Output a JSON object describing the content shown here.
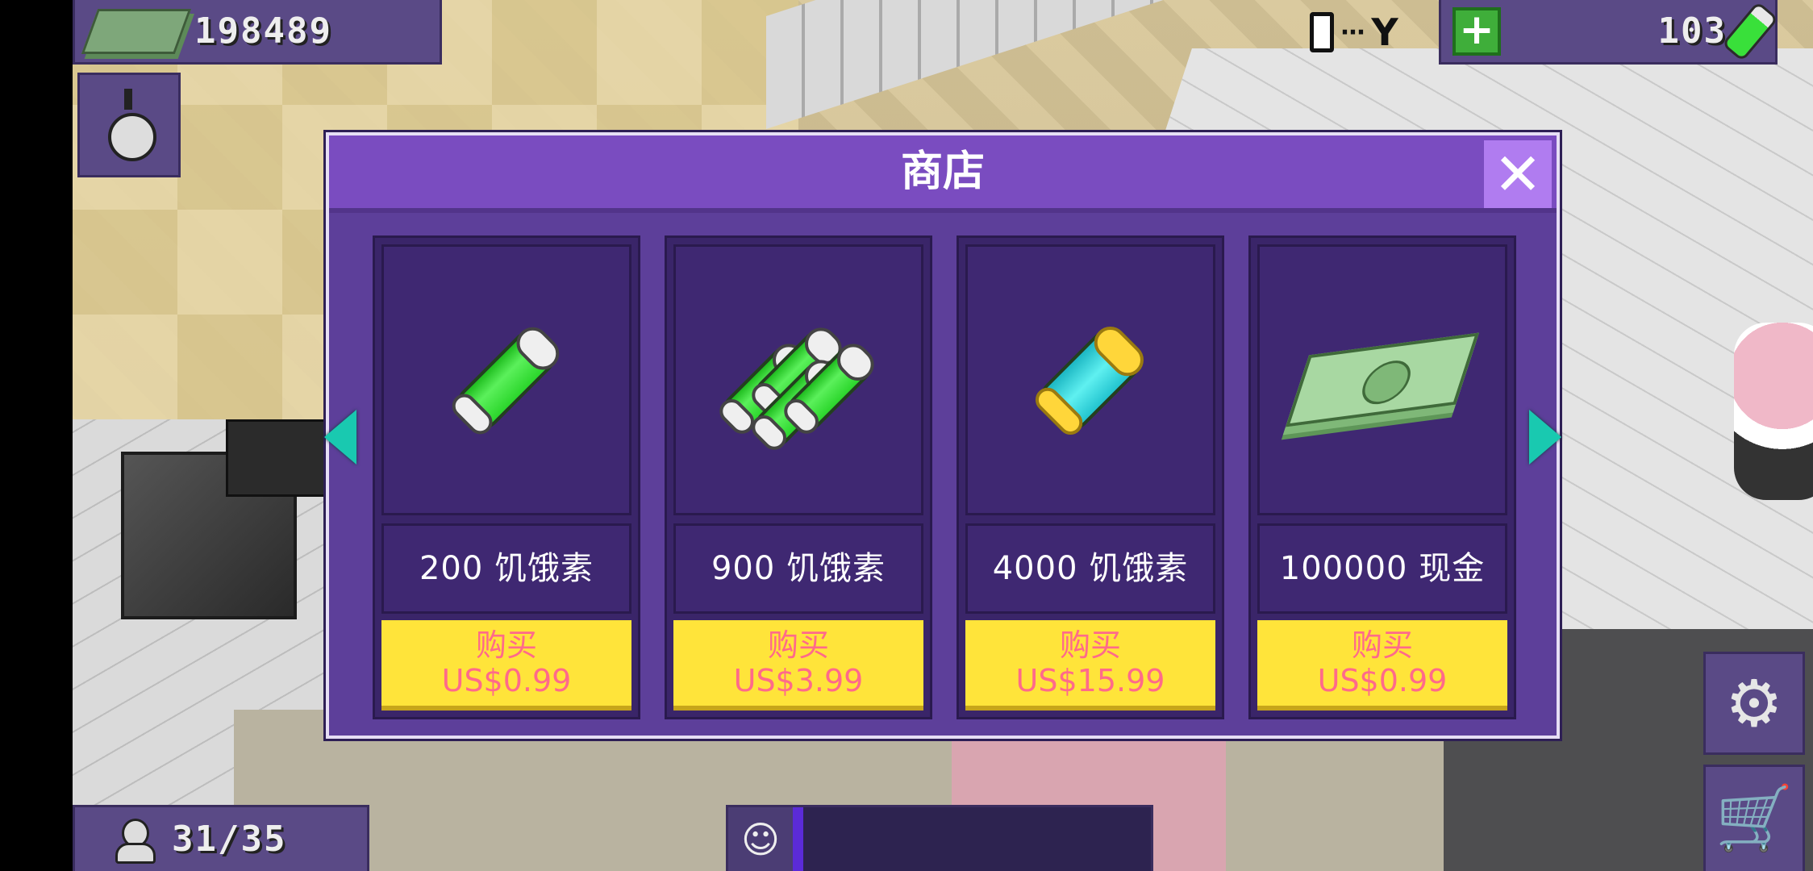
{
  "hud": {
    "money": "198489",
    "hunger_points": "103",
    "population": "31/35",
    "happiness_progress_percent": 3
  },
  "shop": {
    "title": "商店",
    "close_symbol": "✕",
    "products": [
      {
        "label": "200 饥饿素",
        "buy": "购买",
        "price": "US$0.99",
        "icon": "single-hunger-tube-icon"
      },
      {
        "label": "900 饥饿素",
        "buy": "购买",
        "price": "US$3.99",
        "icon": "hunger-tube-bundle-icon"
      },
      {
        "label": "4000 饥饿素",
        "buy": "购买",
        "price": "US$15.99",
        "icon": "cyan-hunger-tube-icon"
      },
      {
        "label": "100000 现金",
        "buy": "购买",
        "price": "US$0.99",
        "icon": "cash-stack-icon"
      }
    ]
  },
  "icons": {
    "settings": "⚙",
    "cart": "🛒",
    "plus": "+",
    "cheer": "☺",
    "signal": "⋯",
    "network": "Y"
  },
  "colors": {
    "panel": "#5d3f9a",
    "header": "#7a4cc0",
    "buy_button": "#ffe43a",
    "price_text": "#ff6a8a",
    "arrow": "#19c9b0"
  }
}
